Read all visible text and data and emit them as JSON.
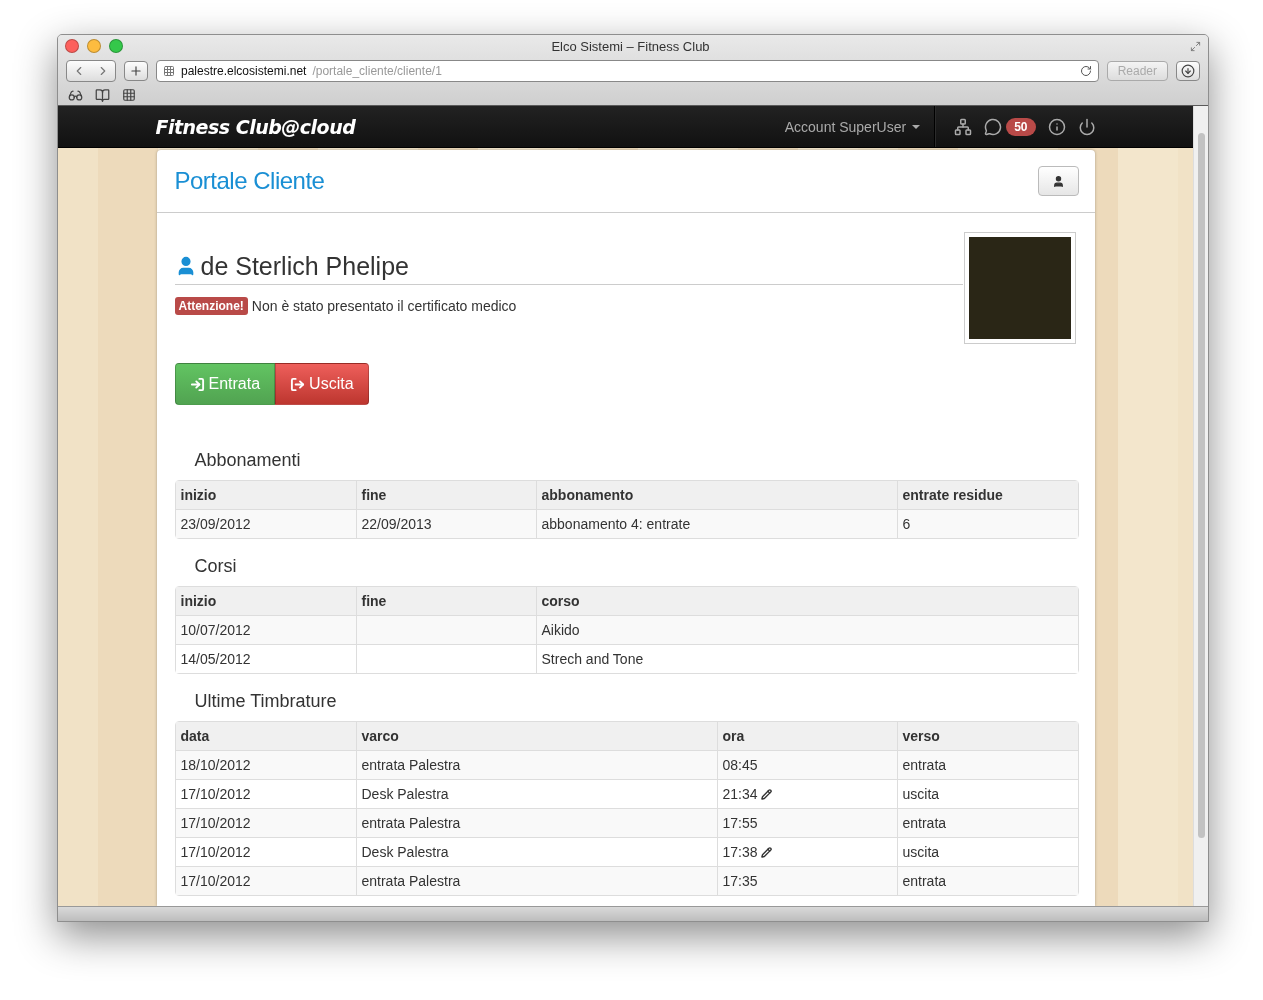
{
  "window": {
    "title": "Elco Sistemi – Fitness Club"
  },
  "address": {
    "domain": "palestre.elcosistemi.net",
    "path": "/portale_cliente/cliente/1",
    "reader": "Reader"
  },
  "navbar": {
    "brand": "Fitness Club@cloud",
    "account": "Account SuperUser",
    "messages_badge": "50"
  },
  "panel": {
    "title": "Portale Cliente"
  },
  "client": {
    "name": "de Sterlich Phelipe",
    "warning_label": "Attenzione!",
    "warning_text": "Non è stato presentato il certificato medico"
  },
  "actions": [
    {
      "label": "Entrata",
      "kind": "entry"
    },
    {
      "label": "Uscita",
      "kind": "exit"
    }
  ],
  "sections": [
    {
      "title": "Abbonamenti",
      "columns": [
        "inizio",
        "fine",
        "abbonamento",
        "entrate residue"
      ],
      "rows": [
        [
          "23/09/2012",
          "22/09/2013",
          "abbonamento 4: entrate",
          "6"
        ]
      ]
    },
    {
      "title": "Corsi",
      "columns": [
        "inizio",
        "fine",
        "corso"
      ],
      "rows": [
        [
          "10/07/2012",
          null,
          "Aikido"
        ],
        [
          "14/05/2012",
          null,
          "Strech and Tone"
        ]
      ]
    },
    {
      "title": "Ultime Timbrature",
      "columns": [
        "data",
        "varco",
        "ora",
        "verso"
      ],
      "rows": [
        [
          "18/10/2012",
          "entrata Palestra",
          {
            "text": "08:45",
            "edited": false
          },
          "entrata"
        ],
        [
          "17/10/2012",
          "Desk Palestra",
          {
            "text": "21:34",
            "edited": true
          },
          "uscita"
        ],
        [
          "17/10/2012",
          "entrata Palestra",
          {
            "text": "17:55",
            "edited": false
          },
          "entrata"
        ],
        [
          "17/10/2012",
          "Desk Palestra",
          {
            "text": "17:38",
            "edited": true
          },
          "uscita"
        ],
        [
          "17/10/2012",
          "entrata Palestra",
          {
            "text": "17:35",
            "edited": false
          },
          "entrata"
        ]
      ]
    }
  ]
}
